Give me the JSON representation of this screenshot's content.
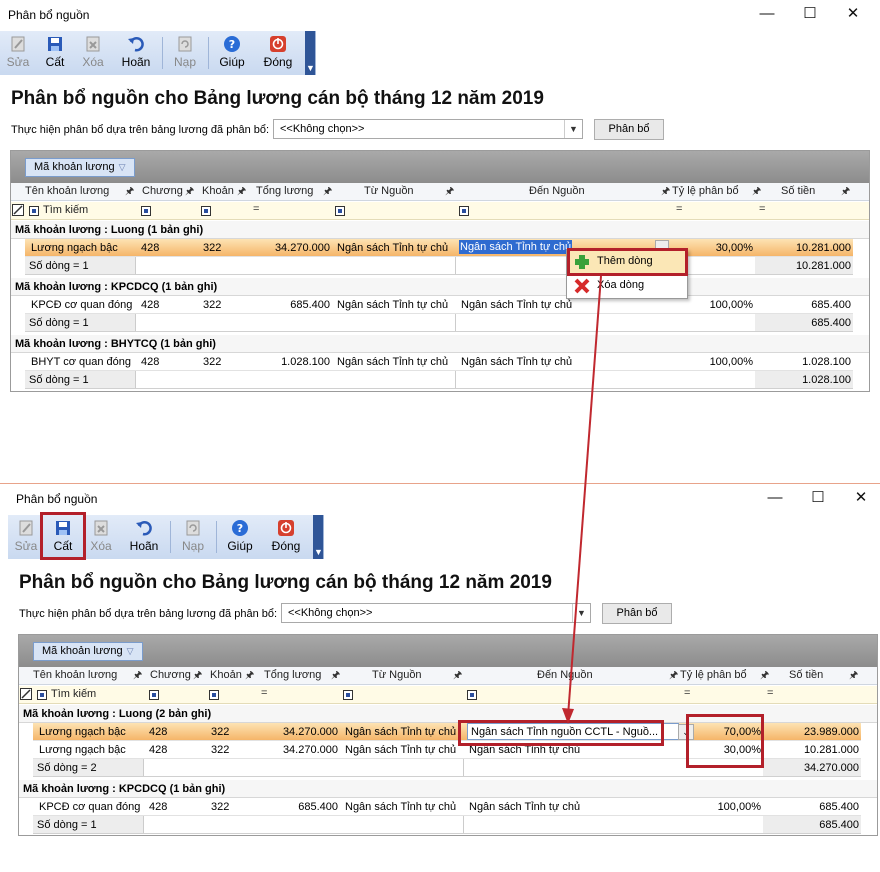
{
  "top": {
    "window_title": "Phân bổ nguồn",
    "toolbar": [
      {
        "label": "Sửa",
        "icon": "edit-icon",
        "disabled": true
      },
      {
        "label": "Cất",
        "icon": "save-icon",
        "disabled": false
      },
      {
        "label": "Xóa",
        "icon": "delete-icon",
        "disabled": true
      },
      {
        "label": "Hoãn",
        "icon": "undo-icon",
        "disabled": false
      },
      {
        "label": "Nạp",
        "icon": "reload-icon",
        "disabled": true
      },
      {
        "label": "Giúp",
        "icon": "help-icon",
        "disabled": false
      },
      {
        "label": "Đóng",
        "icon": "close-circle-icon",
        "disabled": false
      }
    ],
    "heading": "Phân bổ nguồn cho Bảng lương cán bộ tháng 12 năm 2019",
    "filter_label": "Thực hiện phân bổ dựa trên bảng lương đã phân bổ:",
    "combo_value": "<<Không chọn>>",
    "allocate_button": "Phân bổ",
    "group_chip": "Mã khoản lương",
    "columns": [
      "Tên khoản lương",
      "Chương",
      "Khoản",
      "Tổng lương",
      "Từ Nguồn",
      "Đến Nguồn",
      "Tỷ lệ phân bổ",
      "Số tiền"
    ],
    "search_label": "Tìm kiếm",
    "groups": [
      {
        "title": "Mã khoản lương : Luong (1 bản ghi)",
        "rows": [
          {
            "name": "Lương ngạch bậc",
            "chuong": "428",
            "khoan": "322",
            "tong": "34.270.000",
            "tu": "Ngân sách Tỉnh tự chủ",
            "den": "Ngân sách Tỉnh tự chủ",
            "tyle": "30,00%",
            "sotien": "10.281.000"
          }
        ],
        "count": "Số dòng = 1",
        "total": "10.281.000"
      },
      {
        "title": "Mã khoản lương : KPCDCQ (1 bản ghi)",
        "rows": [
          {
            "name": "KPCĐ cơ quan đóng",
            "chuong": "428",
            "khoan": "322",
            "tong": "685.400",
            "tu": "Ngân sách Tỉnh tự chủ",
            "den": "Ngân sách Tỉnh tự chủ",
            "tyle": "100,00%",
            "sotien": "685.400"
          }
        ],
        "count": "Số dòng = 1",
        "total": "685.400"
      },
      {
        "title": "Mã khoản lương : BHYTCQ (1 bản ghi)",
        "rows": [
          {
            "name": "BHYT cơ quan đóng",
            "chuong": "428",
            "khoan": "322",
            "tong": "1.028.100",
            "tu": "Ngân sách Tỉnh tự chủ",
            "den": "Ngân sách Tỉnh tự chủ",
            "tyle": "100,00%",
            "sotien": "1.028.100"
          }
        ],
        "count": "Số dòng = 1",
        "total": "1.028.100"
      }
    ],
    "context_menu": [
      "Thêm dòng",
      "Xóa dòng"
    ]
  },
  "bottom": {
    "window_title": "Phân bổ nguồn",
    "toolbar": [
      {
        "label": "Sửa",
        "icon": "edit-icon",
        "disabled": true
      },
      {
        "label": "Cất",
        "icon": "save-icon",
        "disabled": false
      },
      {
        "label": "Xóa",
        "icon": "delete-icon",
        "disabled": true
      },
      {
        "label": "Hoãn",
        "icon": "undo-icon",
        "disabled": false
      },
      {
        "label": "Nạp",
        "icon": "reload-icon",
        "disabled": true
      },
      {
        "label": "Giúp",
        "icon": "help-icon",
        "disabled": false
      },
      {
        "label": "Đóng",
        "icon": "close-circle-icon",
        "disabled": false
      }
    ],
    "heading": "Phân bổ nguồn cho Bảng lương cán bộ tháng 12 năm 2019",
    "filter_label": "Thực hiện phân bổ dựa trên bảng lương đã phân bổ:",
    "combo_value": "<<Không chọn>>",
    "allocate_button": "Phân bổ",
    "group_chip": "Mã khoản lương",
    "columns": [
      "Tên khoản lương",
      "Chương",
      "Khoản",
      "Tổng lương",
      "Từ Nguồn",
      "Đến Nguồn",
      "Tỷ lệ phân bổ",
      "Số tiền"
    ],
    "search_label": "Tìm kiếm",
    "groups": [
      {
        "title": "Mã khoản lương : Luong (2 bản ghi)",
        "rows": [
          {
            "name": "Lương ngạch bậc",
            "chuong": "428",
            "khoan": "322",
            "tong": "34.270.000",
            "tu": "Ngân sách Tỉnh tự chủ",
            "den": "Ngân sách Tỉnh nguồn CCTL - Nguồ...",
            "tyle": "70,00%",
            "sotien": "23.989.000"
          },
          {
            "name": "Lương ngạch bậc",
            "chuong": "428",
            "khoan": "322",
            "tong": "34.270.000",
            "tu": "Ngân sách Tỉnh tự chủ",
            "den": "Ngân sách Tỉnh tự chủ",
            "tyle": "30,00%",
            "sotien": "10.281.000"
          }
        ],
        "count": "Số dòng = 2",
        "total": "34.270.000"
      },
      {
        "title": "Mã khoản lương : KPCDCQ (1 bản ghi)",
        "rows": [
          {
            "name": "KPCĐ cơ quan đóng",
            "chuong": "428",
            "khoan": "322",
            "tong": "685.400",
            "tu": "Ngân sách Tỉnh tự chủ",
            "den": "Ngân sách Tỉnh tự chủ",
            "tyle": "100,00%",
            "sotien": "685.400"
          }
        ],
        "count": "Số dòng = 1",
        "total": "685.400"
      }
    ]
  },
  "colors": {
    "highlight": "#b3202a",
    "toolbar": "#c9d9f0",
    "selected_row": "#f5b569"
  }
}
